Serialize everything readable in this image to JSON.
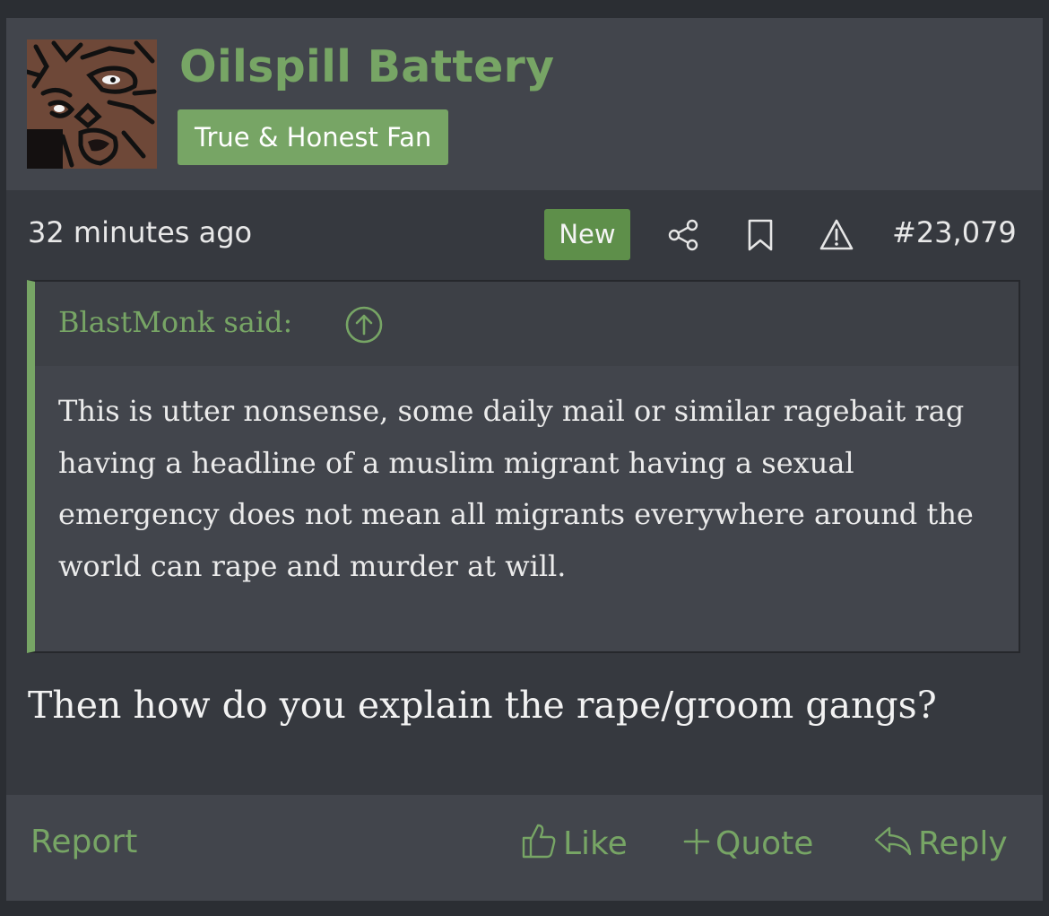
{
  "user": {
    "name": "Oilspill Battery",
    "title": "True & Honest Fan"
  },
  "meta": {
    "date": "32 minutes ago",
    "new_badge": "New",
    "post_number": "#23,079",
    "icons": [
      "share-icon",
      "bookmark-icon",
      "warning-icon"
    ]
  },
  "quote": {
    "author": "BlastMonk said:",
    "text": "This is utter nonsense, some daily mail or similar ragebait rag having a headline of a muslim migrant having a sexual emergency does not mean all migrants everywhere around the world can rape and murder at will."
  },
  "post": {
    "body": "Then how do you explain the rape/groom gangs?"
  },
  "footer": {
    "report": "Report",
    "like": "Like",
    "quote": "Quote",
    "reply": "Reply"
  },
  "colors": {
    "accent": "#77a565",
    "new_badge": "#5e8f4a",
    "background": "#36393f",
    "header": "#42454c"
  }
}
